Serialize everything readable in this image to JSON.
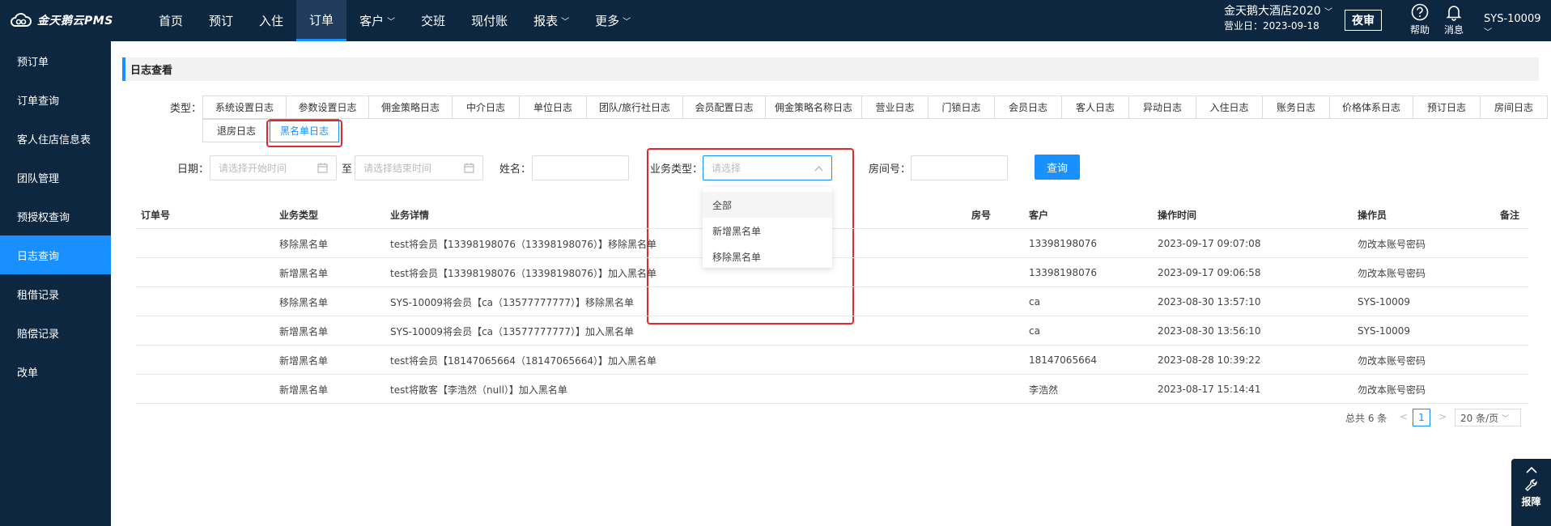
{
  "header": {
    "logo_text": "金天鹅云PMS",
    "nav": [
      {
        "label": "首页",
        "has_menu": false,
        "active": false
      },
      {
        "label": "预订",
        "has_menu": false,
        "active": false
      },
      {
        "label": "入住",
        "has_menu": false,
        "active": false
      },
      {
        "label": "订单",
        "has_menu": false,
        "active": true
      },
      {
        "label": "客户",
        "has_menu": true,
        "active": false
      },
      {
        "label": "交班",
        "has_menu": false,
        "active": false
      },
      {
        "label": "现付账",
        "has_menu": false,
        "active": false
      },
      {
        "label": "报表",
        "has_menu": true,
        "active": false
      },
      {
        "label": "更多",
        "has_menu": true,
        "active": false
      }
    ],
    "hotel_name": "金天鹅大酒店2020",
    "business_day": "营业日：2023-09-18",
    "night_audit": "夜审",
    "help": "帮助",
    "messages": "消息",
    "user": "SYS-10009"
  },
  "sidebar": {
    "items": [
      {
        "label": "预订单",
        "active": false
      },
      {
        "label": "订单查询",
        "active": false
      },
      {
        "label": "客人住店信息表",
        "active": false
      },
      {
        "label": "团队管理",
        "active": false
      },
      {
        "label": "预授权查询",
        "active": false
      },
      {
        "label": "日志查询",
        "active": true
      },
      {
        "label": "租借记录",
        "active": false
      },
      {
        "label": "赔偿记录",
        "active": false
      },
      {
        "label": "改单",
        "active": false
      }
    ]
  },
  "page": {
    "section_title": "日志查看",
    "type_label": "类型：",
    "log_tabs": [
      "系统设置日志",
      "参数设置日志",
      "佣金策略日志",
      "中介日志",
      "单位日志",
      "团队/旅行社日志",
      "会员配置日志",
      "佣金策略名称日志",
      "营业日志",
      "门锁日志",
      "会员日志",
      "客人日志",
      "异动日志",
      "入住日志",
      "账务日志",
      "价格体系日志",
      "预订日志",
      "房间日志",
      "退房日志",
      "黑名单日志"
    ],
    "active_tab": "黑名单日志"
  },
  "filters": {
    "date_label": "日期：",
    "start_placeholder": "请选择开始时间",
    "to_label": "至",
    "end_placeholder": "请选择结束时间",
    "name_label": "姓名：",
    "biz_type_label": "业务类型：",
    "biz_type_placeholder": "请选择",
    "room_label": "房间号：",
    "query_button": "查询"
  },
  "dropdown": {
    "options": [
      "全部",
      "新增黑名单",
      "移除黑名单"
    ]
  },
  "table": {
    "columns": [
      "订单号",
      "业务类型",
      "业务详情",
      "房号",
      "客户",
      "操作时间",
      "操作员",
      "备注"
    ],
    "rows": [
      [
        "",
        "移除黑名单",
        "test将会员【13398198076（13398198076）】移除黑名单",
        "",
        "13398198076",
        "2023-09-17 09:07:08",
        "勿改本账号密码",
        ""
      ],
      [
        "",
        "新增黑名单",
        "test将会员【13398198076（13398198076）】加入黑名单",
        "",
        "13398198076",
        "2023-09-17 09:06:58",
        "勿改本账号密码",
        ""
      ],
      [
        "",
        "移除黑名单",
        "SYS-10009将会员【ca（13577777777）】移除黑名单",
        "",
        "ca",
        "2023-08-30 13:57:10",
        "SYS-10009",
        ""
      ],
      [
        "",
        "新增黑名单",
        "SYS-10009将会员【ca（13577777777）】加入黑名单",
        "",
        "ca",
        "2023-08-30 13:56:10",
        "SYS-10009",
        ""
      ],
      [
        "",
        "新增黑名单",
        "test将会员【18147065664（18147065664）】加入黑名单",
        "",
        "18147065664",
        "2023-08-28 10:39:22",
        "勿改本账号密码",
        ""
      ],
      [
        "",
        "新增黑名单",
        "test将散客【李浩然（null）】加入黑名单",
        "",
        "李浩然",
        "2023-08-17 15:14:41",
        "勿改本账号密码",
        ""
      ]
    ]
  },
  "pagination": {
    "total": "总共 6 条",
    "current": "1",
    "page_size": "20 条/页"
  },
  "report": {
    "label": "报障"
  },
  "colors": {
    "nav_bg": "#0e2741",
    "accent": "#1890ff",
    "highlight": "#e0282e"
  }
}
